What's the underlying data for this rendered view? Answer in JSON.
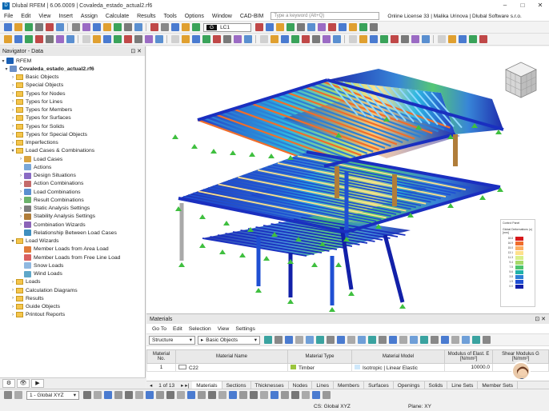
{
  "window": {
    "title": "Dlubal RFEM | 6.06.0009 | Covaleda_estado_actual2.rf6",
    "controls": [
      "–",
      "□",
      "✕"
    ]
  },
  "menu": {
    "items": [
      "File",
      "Edit",
      "View",
      "Insert",
      "Assign",
      "Calculate",
      "Results",
      "Tools",
      "Options",
      "Window",
      "CAD-BIM"
    ],
    "search_placeholder": "Type a keyword (Alt+Q)",
    "license": "Online License 33 | Malika Urinova | Dlubal Software s.r.o."
  },
  "toolbar": {
    "load_case_g": "G",
    "load_case": "LC1"
  },
  "navigator": {
    "title": "Navigator - Data",
    "root": "RFEM",
    "file": "Covaleda_estado_actual2.rf6",
    "items": [
      {
        "label": "Basic Objects",
        "level": 1,
        "icon": "folder"
      },
      {
        "label": "Special Objects",
        "level": 1,
        "icon": "folder"
      },
      {
        "label": "Types for Nodes",
        "level": 1,
        "icon": "folder"
      },
      {
        "label": "Types for Lines",
        "level": 1,
        "icon": "folder"
      },
      {
        "label": "Types for Members",
        "level": 1,
        "icon": "folder"
      },
      {
        "label": "Types for Surfaces",
        "level": 1,
        "icon": "folder"
      },
      {
        "label": "Types for Solids",
        "level": 1,
        "icon": "folder"
      },
      {
        "label": "Types for Special Objects",
        "level": 1,
        "icon": "folder"
      },
      {
        "label": "Imperfections",
        "level": 1,
        "icon": "folder"
      },
      {
        "label": "Load Cases & Combinations",
        "level": 1,
        "icon": "folder",
        "open": true
      },
      {
        "label": "Load Cases",
        "level": 2,
        "icon": "load-cases"
      },
      {
        "label": "Actions",
        "level": 2,
        "icon": "actions"
      },
      {
        "label": "Design Situations",
        "level": 2,
        "icon": "design-situations"
      },
      {
        "label": "Action Combinations",
        "level": 2,
        "icon": "action-combinations"
      },
      {
        "label": "Load Combinations",
        "level": 2,
        "icon": "load-combinations"
      },
      {
        "label": "Result Combinations",
        "level": 2,
        "icon": "result-combinations"
      },
      {
        "label": "Static Analysis Settings",
        "level": 2,
        "icon": "static-settings"
      },
      {
        "label": "Stability Analysis Settings",
        "level": 2,
        "icon": "stability-settings"
      },
      {
        "label": "Combination Wizards",
        "level": 2,
        "icon": "combination-wizards"
      },
      {
        "label": "Relationship Between Load Cases",
        "level": 2,
        "icon": "relationship"
      },
      {
        "label": "Load Wizards",
        "level": 1,
        "icon": "folder",
        "open": true
      },
      {
        "label": "Member Loads from Area Load",
        "level": 2,
        "icon": "area-load"
      },
      {
        "label": "Member Loads from Free Line Load",
        "level": 2,
        "icon": "line-load"
      },
      {
        "label": "Snow Loads",
        "level": 2,
        "icon": "snow"
      },
      {
        "label": "Wind Loads",
        "level": 2,
        "icon": "wind"
      },
      {
        "label": "Loads",
        "level": 1,
        "icon": "folder"
      },
      {
        "label": "Calculation Diagrams",
        "level": 1,
        "icon": "folder"
      },
      {
        "label": "Results",
        "level": 1,
        "icon": "folder"
      },
      {
        "label": "Guide Objects",
        "level": 1,
        "icon": "folder"
      },
      {
        "label": "Printout Reports",
        "level": 1,
        "icon": "folder"
      }
    ]
  },
  "viewport": {
    "legend": {
      "title": "Control Panel",
      "subtitle": "Global Deformations |u| [mm]",
      "values": [
        "18.8",
        "16.9",
        "15.0",
        "13.1",
        "11.3",
        "9.4",
        "7.5",
        "5.6",
        "3.8",
        "1.9",
        "0.0"
      ],
      "colors": [
        "#d7191c",
        "#f06d2b",
        "#fdae61",
        "#fee08b",
        "#d9ef8b",
        "#a6d96a",
        "#4cc46e",
        "#22b3a8",
        "#2d7fd5",
        "#1f4fd3",
        "#1220a8"
      ]
    }
  },
  "materials": {
    "title": "Materials",
    "menu": [
      "Go To",
      "Edit",
      "Selection",
      "View",
      "Settings"
    ],
    "filter": "Structure",
    "objects": "Basic Objects",
    "columns": [
      "Material No.",
      "Material Name",
      "Material Type",
      "Material Model",
      "Modulus of Elast. E [N/mm²]",
      "Shear Modulus G [N/mm²]"
    ],
    "rows": [
      {
        "no": "1",
        "name": "C22",
        "type": "Timber",
        "model": "Isotropic | Linear Elastic",
        "e": "10000.0",
        "g": ""
      }
    ],
    "pager": "1 of 13",
    "tabs": [
      "Materials",
      "Sections",
      "Thicknesses",
      "Nodes",
      "Lines",
      "Members",
      "Surfaces",
      "Openings",
      "Solids",
      "Line Sets",
      "Member Sets"
    ]
  },
  "status": {
    "view": "1 - Global XYZ",
    "cs": "CS: Global XYZ",
    "plane": "Plane: XY"
  }
}
